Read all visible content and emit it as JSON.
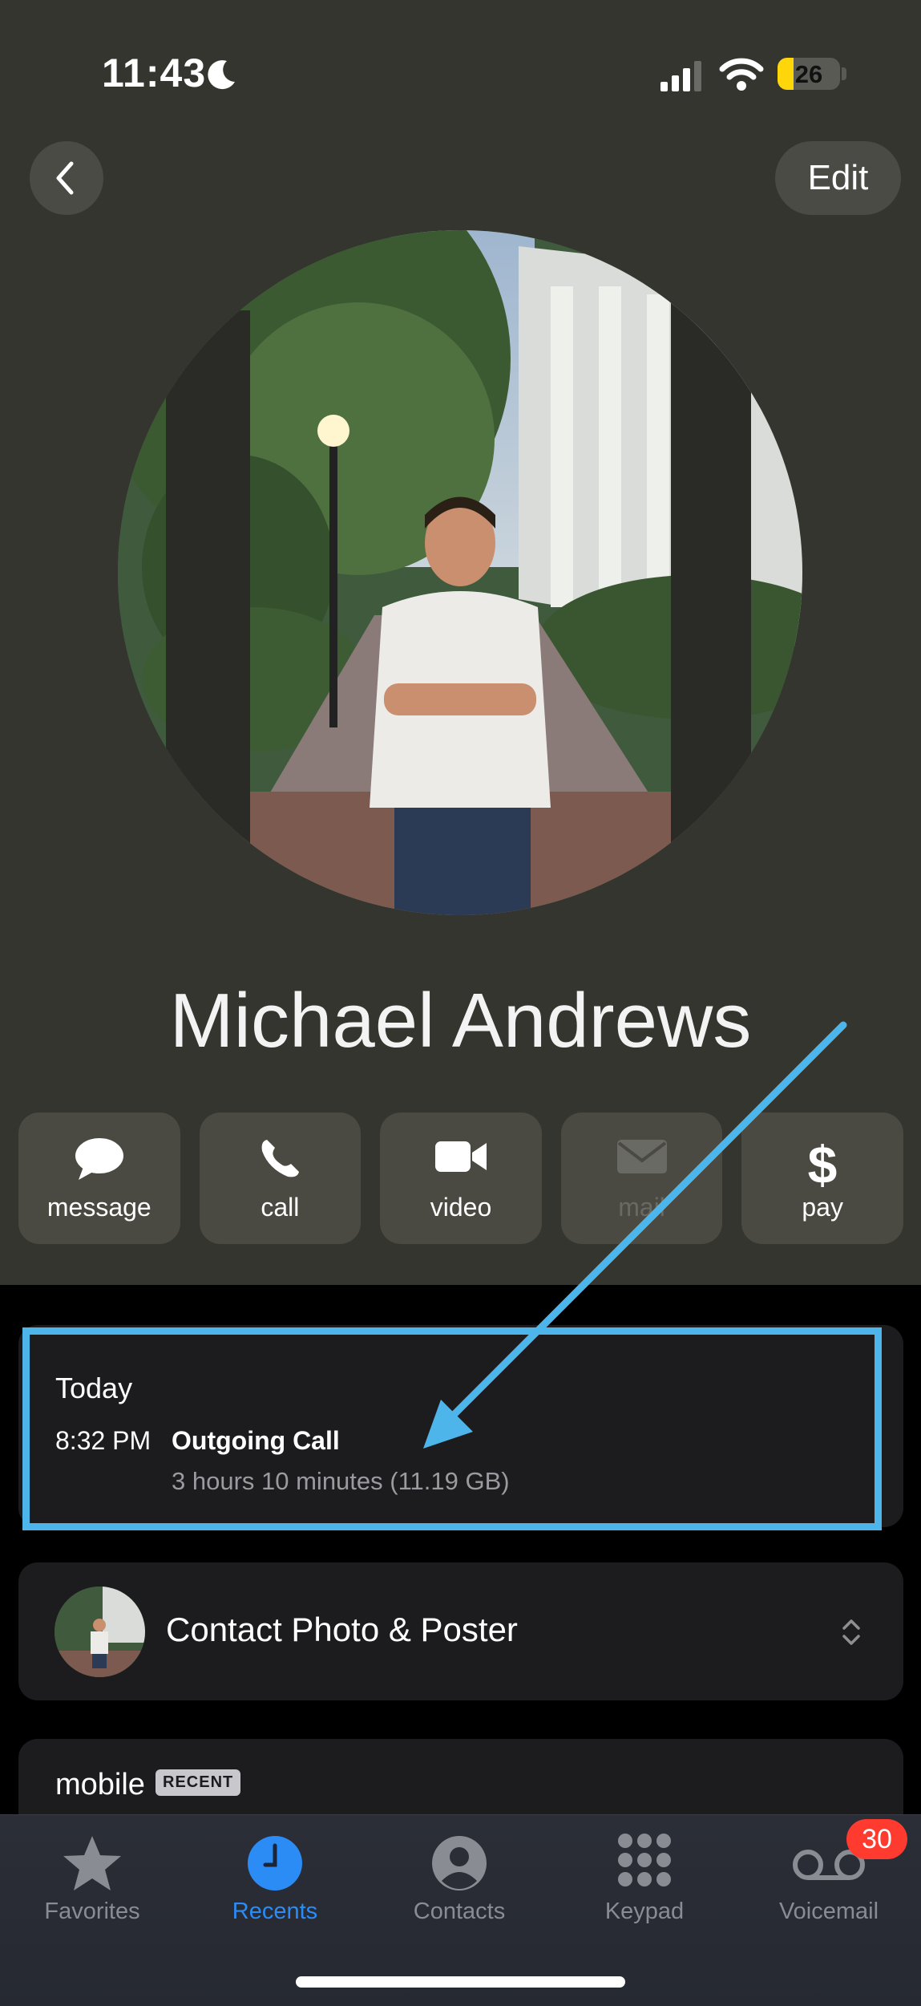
{
  "status_bar": {
    "time": "11:43",
    "battery": "26",
    "battery_level": 0.26
  },
  "header": {
    "edit_label": "Edit"
  },
  "contact": {
    "name": "Michael Andrews"
  },
  "actions": [
    {
      "label": "message",
      "icon": "message-bubble-icon",
      "enabled": true
    },
    {
      "label": "call",
      "icon": "phone-icon",
      "enabled": true
    },
    {
      "label": "video",
      "icon": "video-camera-icon",
      "enabled": true
    },
    {
      "label": "mail",
      "icon": "envelope-icon",
      "enabled": false
    },
    {
      "label": "pay",
      "icon": "dollar-icon",
      "enabled": true
    }
  ],
  "recent_call": {
    "day": "Today",
    "time": "8:32 PM",
    "type": "Outgoing Call",
    "detail": "3 hours 10 minutes (11.19 GB)"
  },
  "poster": {
    "label": "Contact Photo & Poster"
  },
  "phone": {
    "label": "mobile",
    "badge": "RECENT"
  },
  "tabs": [
    {
      "label": "Favorites",
      "icon": "star-icon",
      "active": false
    },
    {
      "label": "Recents",
      "icon": "clock-icon",
      "active": true
    },
    {
      "label": "Contacts",
      "icon": "person-circle-icon",
      "active": false
    },
    {
      "label": "Keypad",
      "icon": "keypad-icon",
      "active": false
    },
    {
      "label": "Voicemail",
      "icon": "voicemail-icon",
      "active": false,
      "badge": "30"
    }
  ],
  "colors": {
    "accent": "#2b8cf6",
    "annotation": "#4db5ea",
    "badge": "#ff3b30",
    "battery": "#ffd60a"
  }
}
